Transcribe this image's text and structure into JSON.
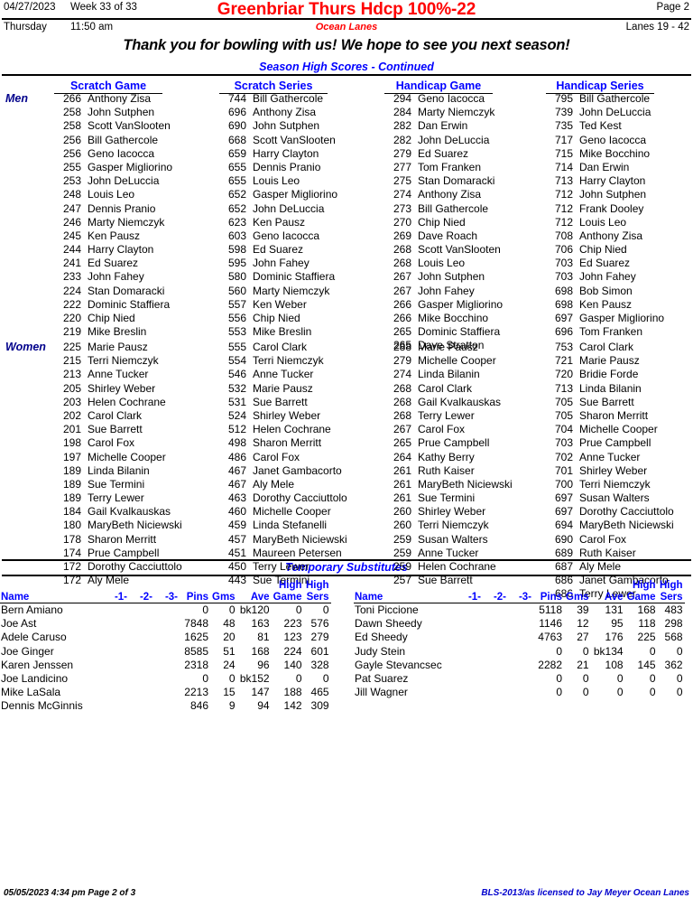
{
  "header": {
    "date": "04/27/2023",
    "week": "Week 33 of 33",
    "title": "Greenbriar Thurs Hdcp 100%-22",
    "page": "Page 2",
    "day": "Thursday",
    "time": "11:50 am",
    "center_name": "Ocean Lanes",
    "lanes": "Lanes 19 - 42",
    "thanks": "Thank you for bowling with us! We hope to see you next season!",
    "section_title": "Season High Scores - Continued"
  },
  "colors": {
    "title_red": "#ff0000",
    "heading_blue": "#0000ff",
    "label_navy": "#00008b",
    "footer_blue": "#0000cd"
  },
  "scores": {
    "column_headers": [
      "Scratch Game",
      "Scratch Series",
      "Handicap Game",
      "Handicap Series"
    ],
    "groups": [
      {
        "label": "Men",
        "columns": [
          [
            {
              "score": "266",
              "name": "Anthony Zisa"
            },
            {
              "score": "258",
              "name": "John Sutphen"
            },
            {
              "score": "258",
              "name": "Scott VanSlooten"
            },
            {
              "score": "256",
              "name": "Bill Gathercole"
            },
            {
              "score": "256",
              "name": "Geno Iacocca"
            },
            {
              "score": "255",
              "name": "Gasper Migliorino"
            },
            {
              "score": "253",
              "name": "John DeLuccia"
            },
            {
              "score": "248",
              "name": "Louis Leo"
            },
            {
              "score": "247",
              "name": "Dennis Pranio"
            },
            {
              "score": "246",
              "name": "Marty Niemczyk"
            },
            {
              "score": "245",
              "name": "Ken Pausz"
            },
            {
              "score": "244",
              "name": "Harry Clayton"
            },
            {
              "score": "241",
              "name": "Ed Suarez"
            },
            {
              "score": "233",
              "name": "John Fahey"
            },
            {
              "score": "224",
              "name": "Stan Domaracki"
            },
            {
              "score": "222",
              "name": "Dominic Staffiera"
            },
            {
              "score": "220",
              "name": "Chip Nied"
            },
            {
              "score": "219",
              "name": "Mike Breslin"
            }
          ],
          [
            {
              "score": "744",
              "name": "Bill Gathercole"
            },
            {
              "score": "696",
              "name": "Anthony Zisa"
            },
            {
              "score": "690",
              "name": "John Sutphen"
            },
            {
              "score": "668",
              "name": "Scott VanSlooten"
            },
            {
              "score": "659",
              "name": "Harry Clayton"
            },
            {
              "score": "655",
              "name": "Dennis Pranio"
            },
            {
              "score": "655",
              "name": "Louis Leo"
            },
            {
              "score": "652",
              "name": "Gasper Migliorino"
            },
            {
              "score": "652",
              "name": "John DeLuccia"
            },
            {
              "score": "623",
              "name": "Ken Pausz"
            },
            {
              "score": "603",
              "name": "Geno Iacocca"
            },
            {
              "score": "598",
              "name": "Ed Suarez"
            },
            {
              "score": "595",
              "name": "John Fahey"
            },
            {
              "score": "580",
              "name": "Dominic Staffiera"
            },
            {
              "score": "560",
              "name": "Marty Niemczyk"
            },
            {
              "score": "557",
              "name": "Ken Weber"
            },
            {
              "score": "556",
              "name": "Chip Nied"
            },
            {
              "score": "553",
              "name": "Mike Breslin"
            }
          ],
          [
            {
              "score": "294",
              "name": "Geno Iacocca"
            },
            {
              "score": "284",
              "name": "Marty Niemczyk"
            },
            {
              "score": "282",
              "name": "Dan Erwin"
            },
            {
              "score": "282",
              "name": "John DeLuccia"
            },
            {
              "score": "279",
              "name": "Ed Suarez"
            },
            {
              "score": "277",
              "name": "Tom Franken"
            },
            {
              "score": "275",
              "name": "Stan Domaracki"
            },
            {
              "score": "274",
              "name": "Anthony Zisa"
            },
            {
              "score": "273",
              "name": "Bill Gathercole"
            },
            {
              "score": "270",
              "name": "Chip Nied"
            },
            {
              "score": "269",
              "name": "Dave Roach"
            },
            {
              "score": "268",
              "name": "Scott VanSlooten"
            },
            {
              "score": "268",
              "name": "Louis Leo"
            },
            {
              "score": "267",
              "name": "John Sutphen"
            },
            {
              "score": "267",
              "name": "John Fahey"
            },
            {
              "score": "266",
              "name": "Gasper Migliorino"
            },
            {
              "score": "266",
              "name": "Mike Bocchino"
            },
            {
              "score": "265",
              "name": "Dominic Staffiera"
            },
            {
              "score": "265",
              "name": "Dave Stratton"
            }
          ],
          [
            {
              "score": "795",
              "name": "Bill Gathercole"
            },
            {
              "score": "739",
              "name": "John DeLuccia"
            },
            {
              "score": "735",
              "name": "Ted Kest"
            },
            {
              "score": "717",
              "name": "Geno Iacocca"
            },
            {
              "score": "715",
              "name": "Mike Bocchino"
            },
            {
              "score": "714",
              "name": "Dan Erwin"
            },
            {
              "score": "713",
              "name": "Harry Clayton"
            },
            {
              "score": "712",
              "name": "John Sutphen"
            },
            {
              "score": "712",
              "name": "Frank Dooley"
            },
            {
              "score": "712",
              "name": "Louis Leo"
            },
            {
              "score": "708",
              "name": "Anthony Zisa"
            },
            {
              "score": "706",
              "name": "Chip Nied"
            },
            {
              "score": "703",
              "name": "Ed Suarez"
            },
            {
              "score": "703",
              "name": "John Fahey"
            },
            {
              "score": "698",
              "name": "Bob Simon"
            },
            {
              "score": "698",
              "name": "Ken Pausz"
            },
            {
              "score": "697",
              "name": "Gasper Migliorino"
            },
            {
              "score": "696",
              "name": "Tom Franken"
            }
          ]
        ]
      },
      {
        "label": "Women",
        "columns": [
          [
            {
              "score": "225",
              "name": "Marie Pausz"
            },
            {
              "score": "215",
              "name": "Terri Niemczyk"
            },
            {
              "score": "213",
              "name": "Anne Tucker"
            },
            {
              "score": "205",
              "name": "Shirley Weber"
            },
            {
              "score": "203",
              "name": "Helen Cochrane"
            },
            {
              "score": "202",
              "name": "Carol Clark"
            },
            {
              "score": "201",
              "name": "Sue Barrett"
            },
            {
              "score": "198",
              "name": "Carol Fox"
            },
            {
              "score": "197",
              "name": "Michelle Cooper"
            },
            {
              "score": "189",
              "name": "Linda Bilanin"
            },
            {
              "score": "189",
              "name": "Sue Termini"
            },
            {
              "score": "189",
              "name": "Terry Lewer"
            },
            {
              "score": "184",
              "name": "Gail Kvalkauskas"
            },
            {
              "score": "180",
              "name": "MaryBeth Niciewski"
            },
            {
              "score": "178",
              "name": "Sharon Merritt"
            },
            {
              "score": "174",
              "name": "Prue Campbell"
            },
            {
              "score": "172",
              "name": "Dorothy Cacciuttolo"
            },
            {
              "score": "172",
              "name": "Aly Mele"
            }
          ],
          [
            {
              "score": "555",
              "name": "Carol Clark"
            },
            {
              "score": "554",
              "name": "Terri Niemczyk"
            },
            {
              "score": "546",
              "name": "Anne Tucker"
            },
            {
              "score": "532",
              "name": "Marie Pausz"
            },
            {
              "score": "531",
              "name": "Sue Barrett"
            },
            {
              "score": "524",
              "name": "Shirley Weber"
            },
            {
              "score": "512",
              "name": "Helen Cochrane"
            },
            {
              "score": "498",
              "name": "Sharon Merritt"
            },
            {
              "score": "486",
              "name": "Carol Fox"
            },
            {
              "score": "467",
              "name": "Janet Gambacorto"
            },
            {
              "score": "467",
              "name": "Aly Mele"
            },
            {
              "score": "463",
              "name": "Dorothy Cacciuttolo"
            },
            {
              "score": "460",
              "name": "Michelle Cooper"
            },
            {
              "score": "459",
              "name": "Linda Stefanelli"
            },
            {
              "score": "457",
              "name": "MaryBeth Niciewski"
            },
            {
              "score": "451",
              "name": "Maureen Petersen"
            },
            {
              "score": "450",
              "name": "Terry Lewer"
            },
            {
              "score": "443",
              "name": "Sue Termini"
            }
          ],
          [
            {
              "score": "288",
              "name": "Marie Pausz"
            },
            {
              "score": "279",
              "name": "Michelle Cooper"
            },
            {
              "score": "274",
              "name": "Linda Bilanin"
            },
            {
              "score": "268",
              "name": "Carol Clark"
            },
            {
              "score": "268",
              "name": "Gail Kvalkauskas"
            },
            {
              "score": "268",
              "name": "Terry Lewer"
            },
            {
              "score": "267",
              "name": "Carol Fox"
            },
            {
              "score": "265",
              "name": "Prue Campbell"
            },
            {
              "score": "264",
              "name": "Kathy Berry"
            },
            {
              "score": "261",
              "name": "Ruth Kaiser"
            },
            {
              "score": "261",
              "name": "MaryBeth Niciewski"
            },
            {
              "score": "261",
              "name": "Sue Termini"
            },
            {
              "score": "260",
              "name": "Shirley Weber"
            },
            {
              "score": "260",
              "name": "Terri Niemczyk"
            },
            {
              "score": "259",
              "name": "Susan Walters"
            },
            {
              "score": "259",
              "name": "Anne Tucker"
            },
            {
              "score": "259",
              "name": "Helen Cochrane"
            },
            {
              "score": "257",
              "name": "Sue Barrett"
            }
          ],
          [
            {
              "score": "753",
              "name": "Carol Clark"
            },
            {
              "score": "721",
              "name": "Marie Pausz"
            },
            {
              "score": "720",
              "name": "Bridie Forde"
            },
            {
              "score": "713",
              "name": "Linda Bilanin"
            },
            {
              "score": "705",
              "name": "Sue Barrett"
            },
            {
              "score": "705",
              "name": "Sharon Merritt"
            },
            {
              "score": "704",
              "name": "Michelle Cooper"
            },
            {
              "score": "703",
              "name": "Prue Campbell"
            },
            {
              "score": "702",
              "name": "Anne Tucker"
            },
            {
              "score": "701",
              "name": "Shirley Weber"
            },
            {
              "score": "700",
              "name": "Terri Niemczyk"
            },
            {
              "score": "697",
              "name": "Susan Walters"
            },
            {
              "score": "697",
              "name": "Dorothy Cacciuttolo"
            },
            {
              "score": "694",
              "name": "MaryBeth Niciewski"
            },
            {
              "score": "690",
              "name": "Carol Fox"
            },
            {
              "score": "689",
              "name": "Ruth Kaiser"
            },
            {
              "score": "687",
              "name": "Aly Mele"
            },
            {
              "score": "686",
              "name": "Janet Gambacorto"
            },
            {
              "score": "686",
              "name": "Terry Lewer"
            }
          ]
        ]
      }
    ]
  },
  "substitutes": {
    "title": "Temporary Substitutes",
    "headers": {
      "name": "Name",
      "g1": "-1-",
      "g2": "-2-",
      "g3": "-3-",
      "pins": "Pins",
      "gms": "Gms",
      "ave": "Ave",
      "high_game_l1": "High",
      "high_game_l2": "Game",
      "high_sers_l1": "High",
      "high_sers_l2": "Sers"
    },
    "left_rows": [
      {
        "name": "Bern Amiano",
        "g1": "",
        "g2": "",
        "g3": "",
        "pins": "0",
        "gms": "0",
        "ave": "120",
        "bk": "bk",
        "hg": "0",
        "hs": "0"
      },
      {
        "name": "Joe Ast",
        "g1": "",
        "g2": "",
        "g3": "",
        "pins": "7848",
        "gms": "48",
        "ave": "163",
        "bk": "",
        "hg": "223",
        "hs": "576"
      },
      {
        "name": "Adele Caruso",
        "g1": "",
        "g2": "",
        "g3": "",
        "pins": "1625",
        "gms": "20",
        "ave": "81",
        "bk": "",
        "hg": "123",
        "hs": "279"
      },
      {
        "name": "Joe Ginger",
        "g1": "",
        "g2": "",
        "g3": "",
        "pins": "8585",
        "gms": "51",
        "ave": "168",
        "bk": "",
        "hg": "224",
        "hs": "601"
      },
      {
        "name": "Karen Jenssen",
        "g1": "",
        "g2": "",
        "g3": "",
        "pins": "2318",
        "gms": "24",
        "ave": "96",
        "bk": "",
        "hg": "140",
        "hs": "328"
      },
      {
        "name": "Joe Landicino",
        "g1": "",
        "g2": "",
        "g3": "",
        "pins": "0",
        "gms": "0",
        "ave": "152",
        "bk": "bk",
        "hg": "0",
        "hs": "0"
      },
      {
        "name": "Mike LaSala",
        "g1": "",
        "g2": "",
        "g3": "",
        "pins": "2213",
        "gms": "15",
        "ave": "147",
        "bk": "",
        "hg": "188",
        "hs": "465"
      },
      {
        "name": "Dennis McGinnis",
        "g1": "",
        "g2": "",
        "g3": "",
        "pins": "846",
        "gms": "9",
        "ave": "94",
        "bk": "",
        "hg": "142",
        "hs": "309"
      }
    ],
    "right_rows": [
      {
        "name": "Toni Piccione",
        "g1": "",
        "g2": "",
        "g3": "",
        "pins": "5118",
        "gms": "39",
        "ave": "131",
        "bk": "",
        "hg": "168",
        "hs": "483"
      },
      {
        "name": "Dawn Sheedy",
        "g1": "",
        "g2": "",
        "g3": "",
        "pins": "1146",
        "gms": "12",
        "ave": "95",
        "bk": "",
        "hg": "118",
        "hs": "298"
      },
      {
        "name": "Ed Sheedy",
        "g1": "",
        "g2": "",
        "g3": "",
        "pins": "4763",
        "gms": "27",
        "ave": "176",
        "bk": "",
        "hg": "225",
        "hs": "568"
      },
      {
        "name": "Judy Stein",
        "g1": "",
        "g2": "",
        "g3": "",
        "pins": "0",
        "gms": "0",
        "ave": "134",
        "bk": "bk",
        "hg": "0",
        "hs": "0"
      },
      {
        "name": "Gayle Stevancsec",
        "g1": "",
        "g2": "",
        "g3": "",
        "pins": "2282",
        "gms": "21",
        "ave": "108",
        "bk": "",
        "hg": "145",
        "hs": "362"
      },
      {
        "name": "Pat Suarez",
        "g1": "",
        "g2": "",
        "g3": "",
        "pins": "0",
        "gms": "0",
        "ave": "0",
        "bk": "",
        "hg": "0",
        "hs": "0"
      },
      {
        "name": "Jill Wagner",
        "g1": "",
        "g2": "",
        "g3": "",
        "pins": "0",
        "gms": "0",
        "ave": "0",
        "bk": "",
        "hg": "0",
        "hs": "0"
      }
    ]
  },
  "footer": {
    "left": "05/05/2023  4:34 pm  Page 2 of 3",
    "right": "BLS-2013/as licensed to Jay Meyer  Ocean Lanes"
  }
}
